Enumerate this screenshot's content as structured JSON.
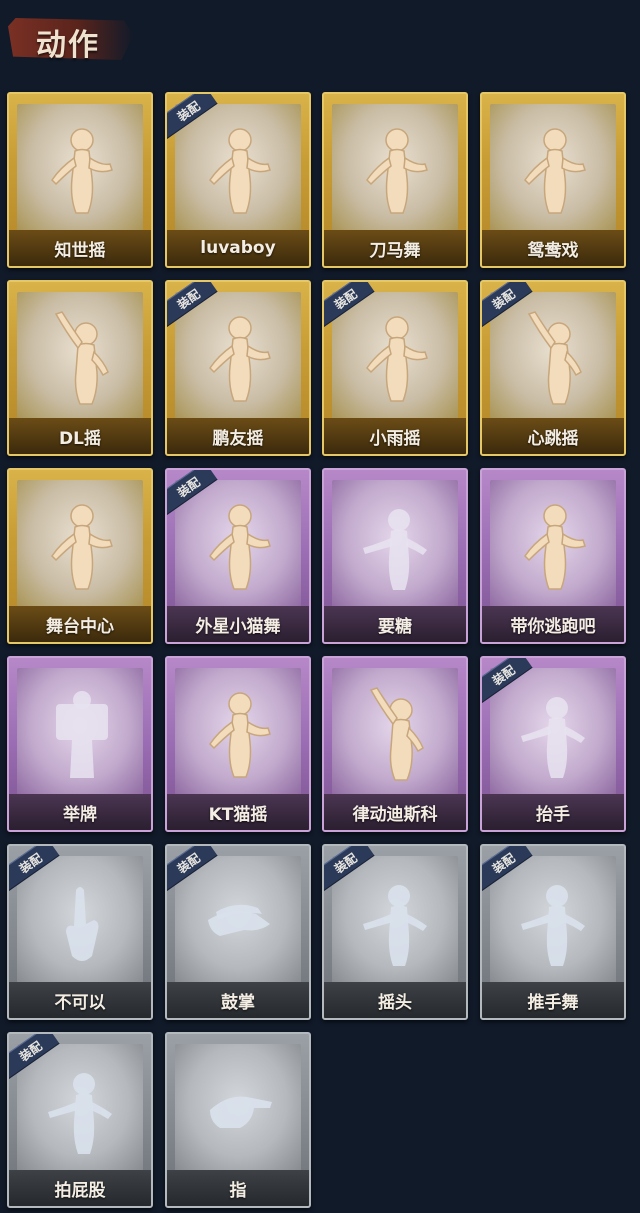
{
  "header": {
    "title": "动作"
  },
  "equipped_label": "装配",
  "colors": {
    "gold": "#c89c35",
    "purple": "#9a6cb3",
    "grey": "#858a90",
    "background": "#111a29"
  },
  "cards": [
    {
      "label": "知世摇",
      "tier": "gold",
      "equipped": false,
      "icon": "pose-dance-icon"
    },
    {
      "label": "luvaboy",
      "tier": "gold",
      "equipped": true,
      "icon": "pose-dance-icon"
    },
    {
      "label": "刀马舞",
      "tier": "gold",
      "equipped": false,
      "icon": "pose-dance-icon"
    },
    {
      "label": "鸳鸯戏",
      "tier": "gold",
      "equipped": false,
      "icon": "pose-dance-icon"
    },
    {
      "label": "DL摇",
      "tier": "gold",
      "equipped": false,
      "icon": "pose-arm-up-icon"
    },
    {
      "label": "鹏友摇",
      "tier": "gold",
      "equipped": true,
      "icon": "pose-dance-icon"
    },
    {
      "label": "小雨摇",
      "tier": "gold",
      "equipped": true,
      "icon": "pose-dance-icon"
    },
    {
      "label": "心跳摇",
      "tier": "gold",
      "equipped": true,
      "icon": "pose-arm-up-icon"
    },
    {
      "label": "舞台中心",
      "tier": "gold",
      "equipped": false,
      "icon": "pose-dance-icon"
    },
    {
      "label": "外星小猫舞",
      "tier": "purple",
      "equipped": true,
      "icon": "pose-dance-icon"
    },
    {
      "label": "要糖",
      "tier": "purple",
      "equipped": false,
      "icon": "pose-ghost-icon"
    },
    {
      "label": "带你逃跑吧",
      "tier": "purple",
      "equipped": false,
      "icon": "pose-dance-icon"
    },
    {
      "label": "举牌",
      "tier": "purple",
      "equipped": false,
      "icon": "pose-sign-icon"
    },
    {
      "label": "KT猫摇",
      "tier": "purple",
      "equipped": false,
      "icon": "pose-dance-icon"
    },
    {
      "label": "律动迪斯科",
      "tier": "purple",
      "equipped": false,
      "icon": "pose-arm-up-icon"
    },
    {
      "label": "抬手",
      "tier": "purple",
      "equipped": true,
      "icon": "pose-ghost-icon"
    },
    {
      "label": "不可以",
      "tier": "grey",
      "equipped": true,
      "icon": "pose-finger-icon"
    },
    {
      "label": "鼓掌",
      "tier": "grey",
      "equipped": true,
      "icon": "pose-clap-icon"
    },
    {
      "label": "摇头",
      "tier": "grey",
      "equipped": true,
      "icon": "pose-ghost-icon"
    },
    {
      "label": "推手舞",
      "tier": "grey",
      "equipped": true,
      "icon": "pose-ghost-icon"
    },
    {
      "label": "拍屁股",
      "tier": "grey",
      "equipped": true,
      "icon": "pose-ghost-icon"
    },
    {
      "label": "指",
      "tier": "grey",
      "equipped": false,
      "icon": "pose-point-icon"
    }
  ]
}
